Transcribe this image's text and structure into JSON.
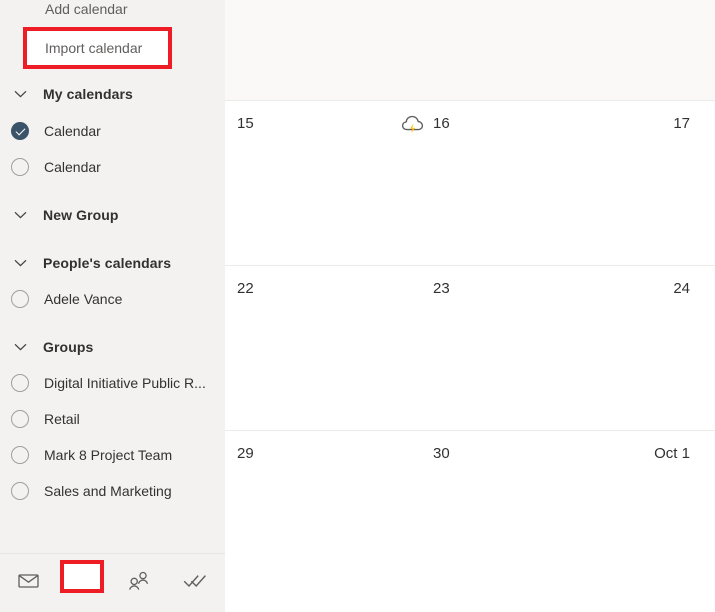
{
  "app": {
    "accent_red": "#ee1c25",
    "sidebar_bg": "#f3f2f1",
    "checked_color": "#3b5368"
  },
  "sidebar": {
    "add_calendar": {
      "label": "Add calendar",
      "icon": "add-calendar-icon"
    },
    "import_calendar": {
      "label": "Import calendar",
      "highlighted": true
    },
    "sections": [
      {
        "id": "my-calendars",
        "header": "My calendars",
        "chevron": "chevron-down-icon",
        "items": [
          {
            "label": "Calendar",
            "checked": true
          },
          {
            "label": "Calendar",
            "checked": false
          }
        ]
      },
      {
        "id": "new-group",
        "header": "New Group",
        "chevron": "chevron-down-icon",
        "items": []
      },
      {
        "id": "peoples-calendars",
        "header": "People's calendars",
        "chevron": "chevron-down-icon",
        "items": [
          {
            "label": "Adele Vance",
            "checked": false
          }
        ]
      },
      {
        "id": "groups",
        "header": "Groups",
        "chevron": "chevron-down-icon",
        "items": [
          {
            "label": "Digital Initiative Public R...",
            "checked": false
          },
          {
            "label": "Retail",
            "checked": false
          },
          {
            "label": "Mark 8 Project Team",
            "checked": false
          },
          {
            "label": "Sales and Marketing",
            "checked": false
          }
        ]
      }
    ],
    "bottom_nav": [
      {
        "id": "mail",
        "icon": "mail-icon",
        "selected": false
      },
      {
        "id": "calendar",
        "icon": "calendar-icon",
        "selected": true
      },
      {
        "id": "people",
        "icon": "people-icon",
        "selected": false
      },
      {
        "id": "tasks",
        "icon": "tasks-icon",
        "selected": false
      }
    ]
  },
  "calendar": {
    "rows": [
      {
        "id": "row-partial",
        "cells": [
          {
            "day": "",
            "weather": null
          },
          {
            "day": "",
            "weather": null
          },
          {
            "day": "",
            "weather": null
          }
        ]
      },
      {
        "id": "row-15",
        "cells": [
          {
            "day": "15",
            "weather": null
          },
          {
            "day": "16",
            "weather": "thunderstorm-icon"
          },
          {
            "day": "17",
            "weather": null
          }
        ]
      },
      {
        "id": "row-22",
        "cells": [
          {
            "day": "22",
            "weather": null
          },
          {
            "day": "23",
            "weather": null
          },
          {
            "day": "24",
            "weather": null
          }
        ]
      },
      {
        "id": "row-29",
        "cells": [
          {
            "day": "29",
            "weather": null
          },
          {
            "day": "30",
            "weather": null
          },
          {
            "day": "Oct 1",
            "weather": null
          }
        ]
      }
    ]
  }
}
